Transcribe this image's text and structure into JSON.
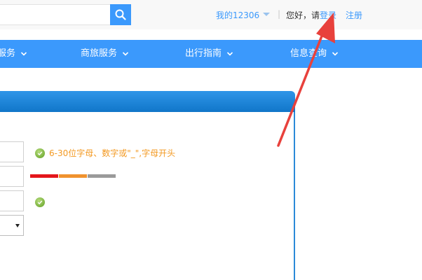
{
  "header": {
    "search_placeholder": "",
    "account_menu": "我的12306",
    "separator": "|",
    "greeting": "您好，请",
    "login": "登录",
    "register": "注册"
  },
  "nav": {
    "items": [
      {
        "label": "服务"
      },
      {
        "label": "商旅服务"
      },
      {
        "label": "出行指南"
      },
      {
        "label": "信息查询"
      }
    ]
  },
  "form": {
    "username_hint": "6-30位字母、数字或\"_\",字母开头",
    "password_strength": [
      "weak",
      "medium",
      "strong"
    ]
  },
  "colors": {
    "accent": "#3b99fc",
    "hint": "#f39a23",
    "strength_weak": "#e4161b",
    "strength_medium": "#f0922e",
    "strength_strong": "#9a9a9a",
    "annotation_arrow": "#e8413c"
  }
}
